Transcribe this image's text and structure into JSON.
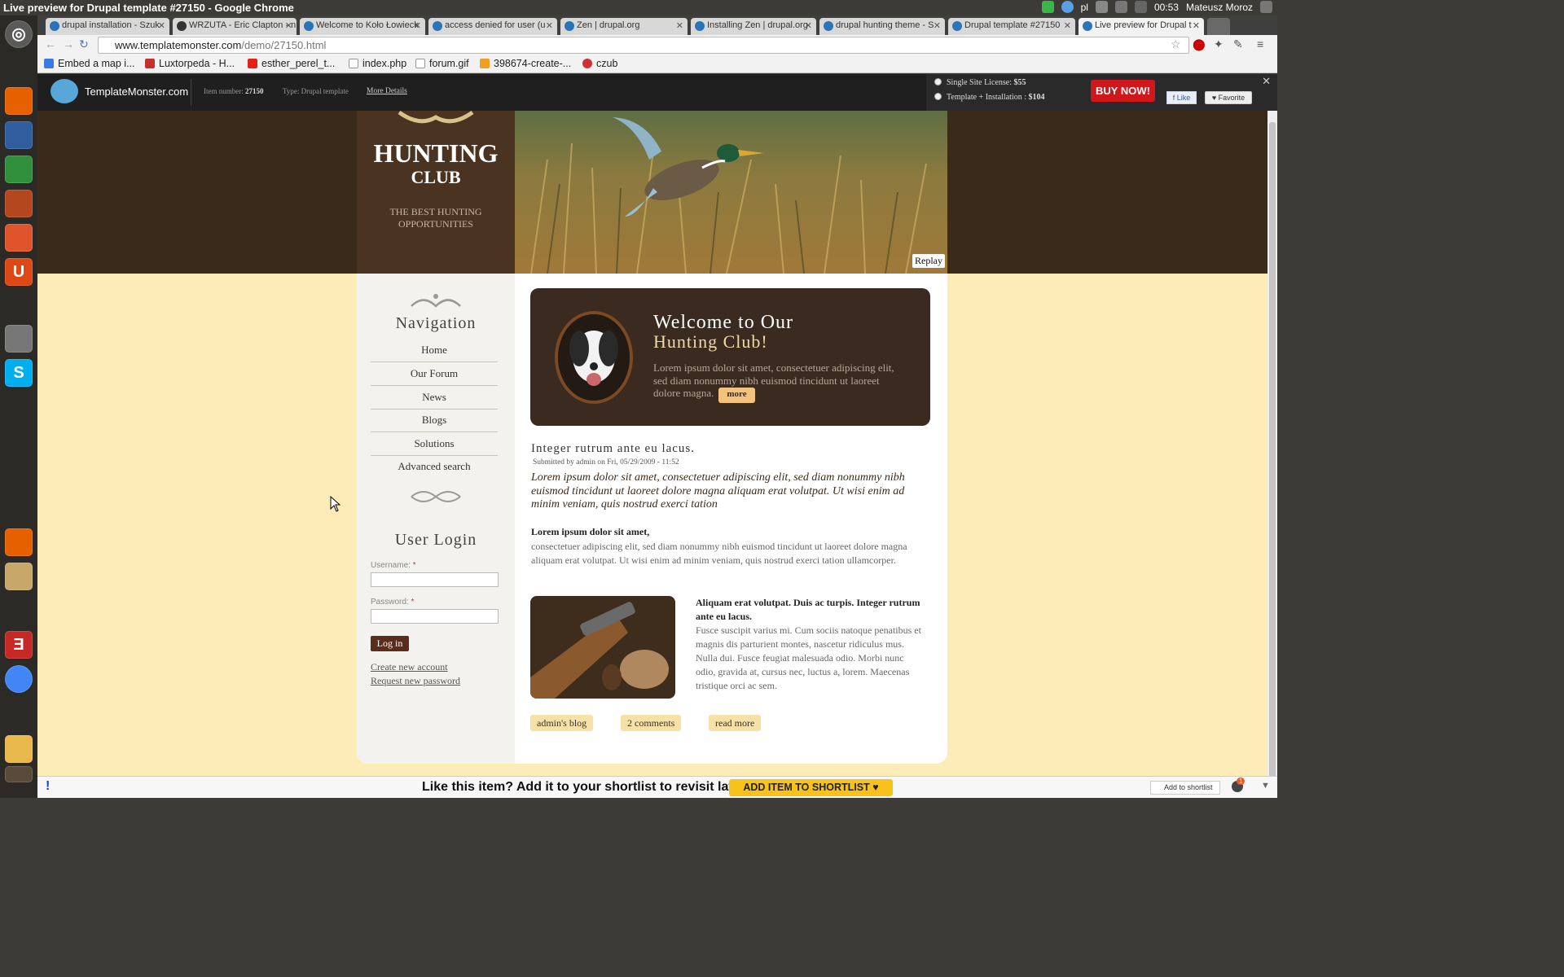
{
  "os": {
    "window_title": "Live preview for Drupal template #27150 - Google Chrome",
    "tray_lang": "pl",
    "clock": "00:53",
    "user": "Mateusz Moroz"
  },
  "tabs": [
    {
      "label": "drupal installation - Szuk"
    },
    {
      "label": "WRZUTA - Eric Clapton - n"
    },
    {
      "label": "Welcome to Koło Łowieck"
    },
    {
      "label": "access denied for user (u"
    },
    {
      "label": "Zen | drupal.org"
    },
    {
      "label": "Installing Zen | drupal.org"
    },
    {
      "label": "drupal hunting theme - S"
    },
    {
      "label": "Drupal template #27150"
    },
    {
      "label": "Live preview for Drupal t"
    }
  ],
  "address": {
    "host": "www.templatemonster.com",
    "path": "/demo/27150.html"
  },
  "bookmarks": [
    {
      "label": "Embed a map i...",
      "color": "#3a7ae4"
    },
    {
      "label": "Luxtorpeda - H...",
      "color": "#c4302b"
    },
    {
      "label": "esther_perel_t...",
      "color": "#e62117"
    },
    {
      "label": "index.php",
      "color": "#ffffff"
    },
    {
      "label": "forum.gif",
      "color": "#ffffff"
    },
    {
      "label": "398674-create-...",
      "color": "#f0a020"
    },
    {
      "label": "czub",
      "color": "#d03030"
    }
  ],
  "tm": {
    "brand": "TemplateMonster.com",
    "item_label": "Item number:",
    "item_value": "27150",
    "type_label": "Type: Drupal template",
    "more_details": "More Details",
    "license1": "Single Site License:",
    "license1_price": "$55",
    "license2": "Template + Installation :",
    "license2_price": "$104",
    "buy": "BUY NOW!",
    "like": "Like",
    "favorite": "Favorite"
  },
  "header": {
    "title1": "HUNTING",
    "title2": "CLUB",
    "tagline": "THE BEST HUNTING OPPORTUNITIES",
    "replay": "Replay"
  },
  "nav": {
    "heading": "Navigation",
    "items": [
      "Home",
      "Our Forum",
      "News",
      "Blogs",
      "Solutions",
      "Advanced search"
    ]
  },
  "login": {
    "heading": "User Login",
    "username_label": "Username:",
    "password_label": "Password:",
    "required_mark": "*",
    "button": "Log in",
    "create": "Create new account",
    "request": "Request new password"
  },
  "welcome": {
    "line1": "Welcome to Our",
    "line2": "Hunting Club!",
    "text": "Lorem ipsum dolor sit amet, consectetuer adipiscing elit, sed diam nonummy nibh euismod tincidunt ut laoreet dolore magna.",
    "more": "more"
  },
  "article": {
    "title": "Integer rutrum ante eu lacus.",
    "submitted": "Submitted by admin on Fri, 05/29/2009 - 11:52",
    "lead": "Lorem ipsum dolor sit amet, consectetuer adipiscing elit, sed diam nonummy nibh euismod tincidunt ut laoreet dolore magna aliquam erat volutpat. Ut wisi enim ad minim veniam, quis nostrud exerci tation",
    "bold": "Lorem ipsum dolor sit amet,",
    "para": "consectetuer adipiscing elit, sed diam nonummy nibh euismod tincidunt ut laoreet dolore magna aliquam erat volutpat. Ut wisi enim ad minim veniam, quis nostrud exerci tation ullamcorper.",
    "side_bold": "Aliquam erat volutpat. Duis ac turpis. Integer rutrum ante eu lacus.",
    "side_para": "Fusce suscipit varius mi. Cum sociis natoque penatibus et magnis dis parturient montes, nascetur ridiculus mus. Nulla dui. Fusce feugiat malesuada odio. Morbi nunc odio, gravida at, cursus nec, luctus a, lorem. Maecenas tristique orci ac sem.",
    "links": [
      "admin's blog",
      "2 comments",
      "read more"
    ]
  },
  "shortlist": {
    "text": "Like this item? Add it to your shortlist to revisit later",
    "button": "ADD ITEM TO SHORTLIST",
    "checkbox": "Add to shortlist",
    "notify_count": "1"
  },
  "colors": {
    "header_dark": "#3a2a1c",
    "page_cream": "#fdebb8",
    "buy_red": "#d0171b",
    "shortlist_yellow": "#f8c21a"
  }
}
